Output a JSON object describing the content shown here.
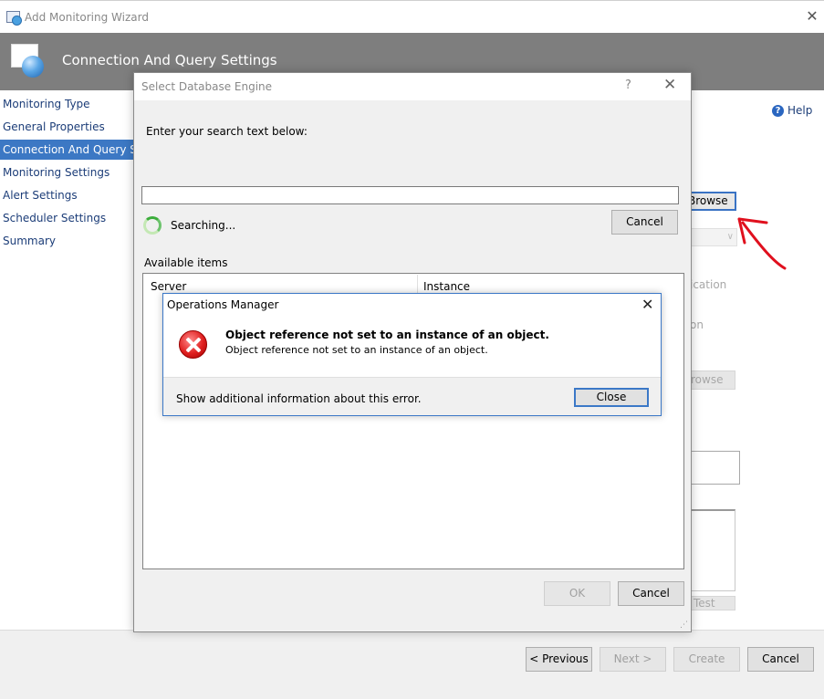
{
  "window": {
    "title": "Add Monitoring Wizard",
    "close_glyph": "✕"
  },
  "header": {
    "title": "Connection And Query Settings"
  },
  "sidebar": {
    "items": [
      {
        "label": "Monitoring Type"
      },
      {
        "label": "General Properties"
      },
      {
        "label": "Connection And Query Settings"
      },
      {
        "label": "Monitoring Settings"
      },
      {
        "label": "Alert Settings"
      },
      {
        "label": "Scheduler Settings"
      },
      {
        "label": "Summary"
      }
    ],
    "selected_index": 2
  },
  "help": {
    "label": "Help",
    "icon_glyph": "?"
  },
  "background_form": {
    "browse_label": "Browse",
    "combo_glyph": "∨",
    "text_fragment_1": "ication",
    "text_fragment_2": "on",
    "browse2_label": "rowse",
    "test_label": "Test"
  },
  "footer": {
    "previous_label": "< Previous",
    "next_label": "Next >",
    "create_label": "Create",
    "cancel_label": "Cancel"
  },
  "select_db_dialog": {
    "title": "Select Database Engine",
    "help_glyph": "?",
    "close_glyph": "✕",
    "prompt": "Enter your search text below:",
    "search_value": "",
    "searching_text": "Searching...",
    "cancel_search_label": "Cancel",
    "available_items_label": "Available items",
    "columns": [
      "Server",
      "Instance"
    ],
    "ok_label": "OK",
    "cancel_label": "Cancel",
    "grip_glyph": "⋰"
  },
  "error_dialog": {
    "title": "Operations Manager",
    "close_glyph": "✕",
    "message_title": "Object reference not set to an instance of an object.",
    "message_detail": "Object reference not set to an instance of an object.",
    "show_info_label": "Show additional information about this error.",
    "close_label": "Close"
  },
  "colors": {
    "selection_blue": "#3c78c4",
    "header_gray": "#7e7e7e",
    "annotation_red": "#e0101e"
  }
}
